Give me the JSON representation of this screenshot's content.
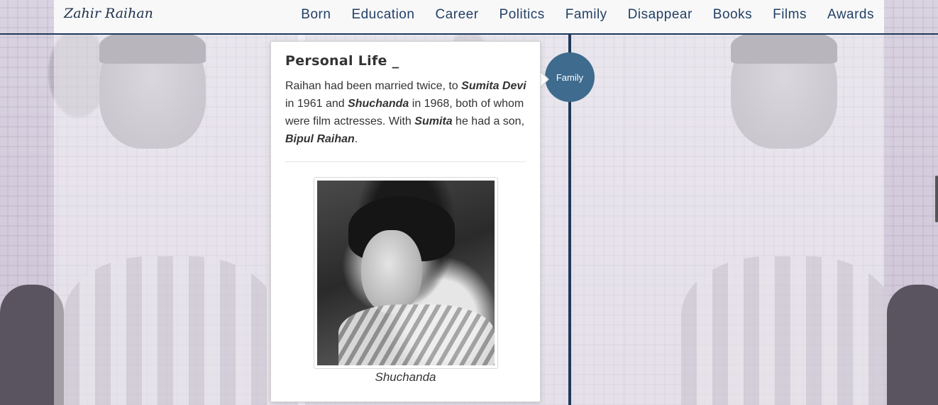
{
  "brand": "Zahir Raihan",
  "nav": {
    "items": [
      {
        "label": "Born"
      },
      {
        "label": "Education"
      },
      {
        "label": "Career"
      },
      {
        "label": "Politics"
      },
      {
        "label": "Family"
      },
      {
        "label": "Disappear"
      },
      {
        "label": "Books"
      },
      {
        "label": "Films"
      },
      {
        "label": "Awards"
      }
    ]
  },
  "timeline": {
    "badge": "Family"
  },
  "panel": {
    "title": "Personal Life _",
    "text": {
      "p1": "Raihan had been married twice, to ",
      "name1": "Sumita Devi",
      "p2": " in 1961 and ",
      "name2": "Shuchanda",
      "p3": " in 1968, both of whom were film actresses. With ",
      "name3": "Sumita",
      "p4": " he had a son, ",
      "name4": "Bipul Raihan",
      "p5": "."
    },
    "photo_caption": "Shuchanda"
  }
}
